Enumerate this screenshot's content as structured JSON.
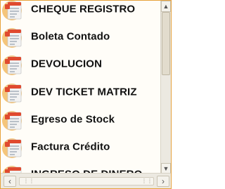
{
  "items": [
    {
      "label": "CHEQUE REGISTRO",
      "icon": "invoice-icon"
    },
    {
      "label": "Boleta Contado",
      "icon": "invoice-icon"
    },
    {
      "label": "DEVOLUCION",
      "icon": "invoice-icon"
    },
    {
      "label": "DEV TICKET MATRIZ",
      "icon": "invoice-icon"
    },
    {
      "label": "Egreso de Stock",
      "icon": "invoice-icon"
    },
    {
      "label": "Factura Crédito",
      "icon": "invoice-icon"
    },
    {
      "label": "INGRESO DE DINERO",
      "icon": "invoice-icon"
    }
  ],
  "scrollbar": {
    "up_glyph": "▲",
    "down_glyph": "▼",
    "left_glyph": "‹",
    "right_glyph": "›"
  },
  "colors": {
    "icon_circle": "#f5c57a",
    "doc_paper": "#f2f2f2",
    "doc_header": "#e04a2f",
    "doc_lines": "#9aa5b1",
    "panel_border": "#e6a23c"
  }
}
